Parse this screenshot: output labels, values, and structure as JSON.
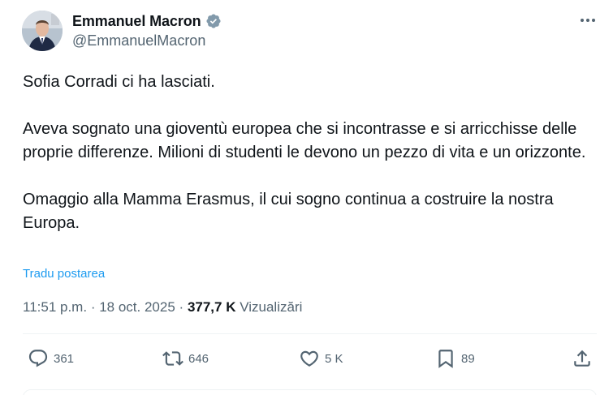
{
  "author": {
    "display_name": "Emmanuel Macron",
    "handle": "@EmmanuelMacron",
    "verified": true,
    "verified_color": "#829aab"
  },
  "tweet": {
    "paragraphs": [
      "Sofia Corradi ci ha lasciati.",
      "Aveva sognato una gioventù europea che si incontrasse e si arricchisse delle proprie differenze. Milioni di studenti le devono un pezzo di vita e un orizzonte.",
      "Omaggio alla Mamma Erasmus, il cui sogno continua a costruire la nostra Europa."
    ],
    "translate_label": "Tradu postarea",
    "time": "11:51 p.m.",
    "separator": "·",
    "date": "18 oct. 2025",
    "views_count": "377,7 K",
    "views_label": "Vizualizări"
  },
  "actions": {
    "replies": "361",
    "reposts": "646",
    "likes": "5 K",
    "bookmarks": "89"
  },
  "icons": {
    "more": "more-icon",
    "reply": "reply-icon",
    "repost": "repost-icon",
    "like": "heart-icon",
    "bookmark": "bookmark-icon",
    "share": "share-icon"
  },
  "colors": {
    "text": "#0f1419",
    "secondary": "#536471",
    "link": "#1d9bf0",
    "divider": "#eff3f4"
  }
}
